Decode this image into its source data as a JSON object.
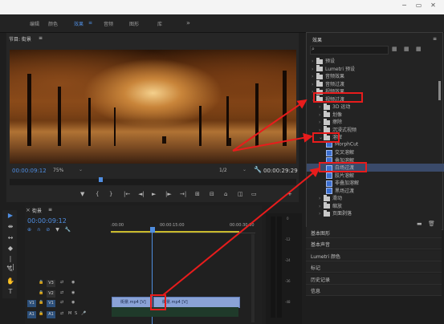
{
  "window": {
    "minimize": "─",
    "restore": "▭",
    "close": "✕"
  },
  "workspaces": [
    {
      "label": "编辑",
      "active": false
    },
    {
      "label": "颜色",
      "active": false
    },
    {
      "label": "效果",
      "active": true
    },
    {
      "label": "音频",
      "active": false
    },
    {
      "label": "图形",
      "active": false
    },
    {
      "label": "库",
      "active": false
    }
  ],
  "workspace_more": "»",
  "program": {
    "title": "节目: 街景",
    "menu": "≡",
    "timecode": "00:00:09:12",
    "zoom": "75%",
    "quality": "1/2",
    "duration": "00:00:29:29"
  },
  "transport": [
    "▼",
    "{",
    "}",
    "|←",
    "◄|",
    "►",
    "|►",
    "→|",
    "⊞",
    "⊟",
    "⌂",
    "◫",
    "▭",
    "+"
  ],
  "effects": {
    "title": "效果",
    "menu": "≡",
    "search_icon": "⌕",
    "tree": [
      {
        "label": "预设",
        "kind": "folder",
        "arrow": "›",
        "indent": 0
      },
      {
        "label": "Lumetri 预设",
        "kind": "folder",
        "arrow": "›",
        "indent": 0
      },
      {
        "label": "音频效果",
        "kind": "folder",
        "arrow": "›",
        "indent": 0
      },
      {
        "label": "音频过渡",
        "kind": "folder",
        "arrow": "›",
        "indent": 0
      },
      {
        "label": "视频效果",
        "kind": "folder",
        "arrow": "›",
        "indent": 0
      },
      {
        "label": "视频过渡",
        "kind": "folder",
        "arrow": "⌄",
        "indent": 0,
        "highlight": true
      },
      {
        "label": "3D 运动",
        "kind": "folder",
        "arrow": "›",
        "indent": 1
      },
      {
        "label": "划像",
        "kind": "folder",
        "arrow": "›",
        "indent": 1
      },
      {
        "label": "擦除",
        "kind": "folder",
        "arrow": "›",
        "indent": 1
      },
      {
        "label": "沉浸式视频",
        "kind": "folder",
        "arrow": "›",
        "indent": 1
      },
      {
        "label": "溶解",
        "kind": "folder",
        "arrow": "⌄",
        "indent": 1,
        "highlight": true
      },
      {
        "label": "MorphCut",
        "kind": "fx",
        "indent": 2
      },
      {
        "label": "交叉溶解",
        "kind": "fx",
        "indent": 2
      },
      {
        "label": "叠加溶解",
        "kind": "fx",
        "indent": 2
      },
      {
        "label": "白场过渡",
        "kind": "fx",
        "indent": 2,
        "highlight": true,
        "selected": true
      },
      {
        "label": "胶片溶解",
        "kind": "fx",
        "indent": 2
      },
      {
        "label": "非叠加溶解",
        "kind": "fx",
        "indent": 2
      },
      {
        "label": "黑场过渡",
        "kind": "fx",
        "indent": 2
      },
      {
        "label": "滑动",
        "kind": "folder",
        "arrow": "›",
        "indent": 1
      },
      {
        "label": "缩放",
        "kind": "folder",
        "arrow": "›",
        "indent": 1
      },
      {
        "label": "页面剥落",
        "kind": "folder",
        "arrow": "›",
        "indent": 1
      }
    ]
  },
  "side_panels": [
    "基本图形",
    "基本声音",
    "Lumetri 颜色",
    "标记",
    "历史记录",
    "信息"
  ],
  "sequence": {
    "close": "×",
    "title": "街景",
    "menu": "≡",
    "timecode": "00:00:09:12",
    "ruler": [
      ":00:00",
      "00:00:15:00",
      "00:00:30:00"
    ],
    "tracks": [
      {
        "id": "V3",
        "badge": "",
        "type": "video"
      },
      {
        "id": "V2",
        "badge": "",
        "type": "video"
      },
      {
        "id": "V1",
        "badge": "V1",
        "type": "video"
      },
      {
        "id": "A1",
        "badge": "A1",
        "type": "audio",
        "s": "S"
      }
    ],
    "clips": [
      {
        "label": "街景.mp4 [V]"
      },
      {
        "label": "街景.mp4 [V]"
      }
    ],
    "meter_scale": [
      "0",
      "-12",
      "-24",
      "-36",
      "-48"
    ],
    "meter_sr": [
      "S",
      "R"
    ]
  },
  "tools": [
    "▶",
    "⇼",
    "↔",
    "◆",
    "|↔|",
    "✎",
    "✋",
    "T"
  ],
  "colors": {
    "accent": "#4f8de0",
    "highlight": "#e81c1c",
    "clip": "#8aa3d6"
  }
}
